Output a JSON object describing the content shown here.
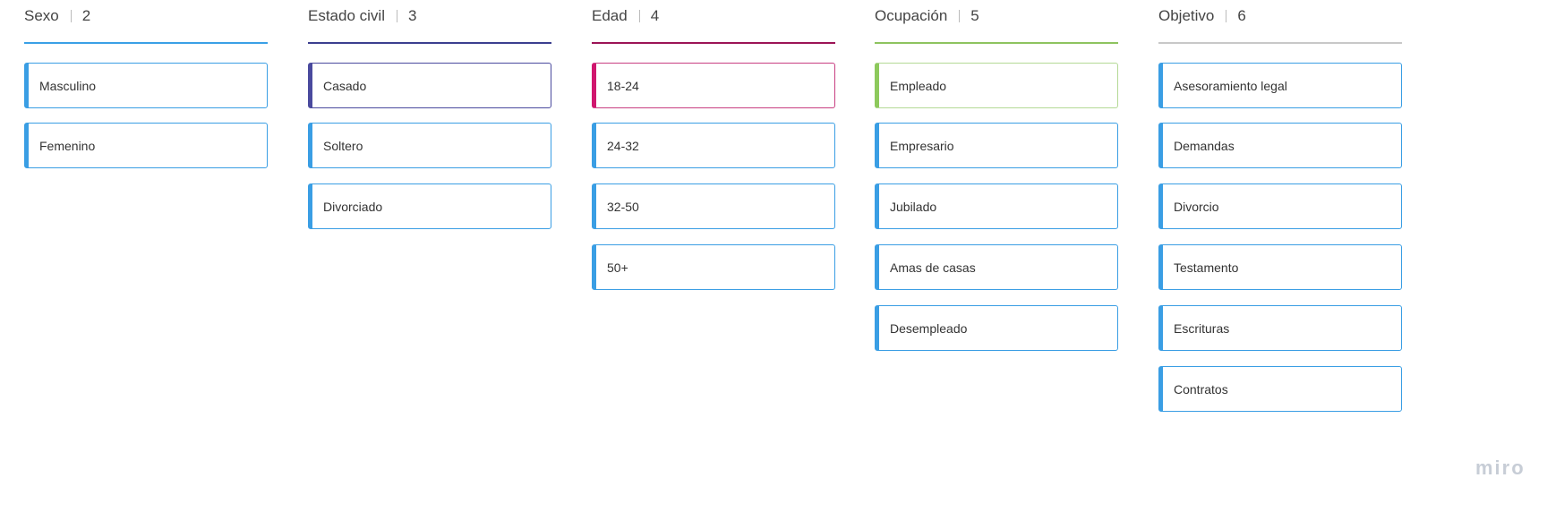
{
  "columns": [
    {
      "title": "Sexo",
      "count": "2",
      "rule_color": "#3aa0e6",
      "items": [
        {
          "label": "Masculino",
          "border": "#3a9ee4",
          "accent": "#3a9ee4"
        },
        {
          "label": "Femenino",
          "border": "#3a9ee4",
          "accent": "#3a9ee4"
        }
      ]
    },
    {
      "title": "Estado civil",
      "count": "3",
      "rule_color": "#3c3f8f",
      "items": [
        {
          "label": "Casado",
          "border": "#4a4a9e",
          "accent": "#4a4a9e"
        },
        {
          "label": "Soltero",
          "border": "#3a9ee4",
          "accent": "#3a9ee4"
        },
        {
          "label": "Divorciado",
          "border": "#3a9ee4",
          "accent": "#3a9ee4"
        }
      ]
    },
    {
      "title": "Edad",
      "count": "4",
      "rule_color": "#9c1456",
      "items": [
        {
          "label": "18-24",
          "border": "#c83f82",
          "accent": "#d0166e"
        },
        {
          "label": "24-32",
          "border": "#3a9ee4",
          "accent": "#3a9ee4"
        },
        {
          "label": "32-50",
          "border": "#3a9ee4",
          "accent": "#3a9ee4"
        },
        {
          "label": "50+",
          "border": "#3a9ee4",
          "accent": "#3a9ee4"
        }
      ]
    },
    {
      "title": "Ocupación",
      "count": "5",
      "rule_color": "#8ec35f",
      "items": [
        {
          "label": "Empleado",
          "border": "#b4d996",
          "accent": "#8dc95c"
        },
        {
          "label": "Empresario",
          "border": "#3a9ee4",
          "accent": "#3a9ee4"
        },
        {
          "label": "Jubilado",
          "border": "#3a9ee4",
          "accent": "#3a9ee4"
        },
        {
          "label": "Amas de casas",
          "border": "#3a9ee4",
          "accent": "#3a9ee4"
        },
        {
          "label": "Desempleado",
          "border": "#3a9ee4",
          "accent": "#3a9ee4"
        }
      ]
    },
    {
      "title": "Objetivo",
      "count": "6",
      "rule_color": "#c8c8c8",
      "items": [
        {
          "label": "Asesoramiento legal",
          "border": "#3a9ee4",
          "accent": "#3a9ee4"
        },
        {
          "label": "Demandas",
          "border": "#3a9ee4",
          "accent": "#3a9ee4"
        },
        {
          "label": "Divorcio",
          "border": "#3a9ee4",
          "accent": "#3a9ee4"
        },
        {
          "label": "Testamento",
          "border": "#3a9ee4",
          "accent": "#3a9ee4"
        },
        {
          "label": "Escrituras",
          "border": "#3a9ee4",
          "accent": "#3a9ee4"
        },
        {
          "label": "Contratos",
          "border": "#3a9ee4",
          "accent": "#3a9ee4"
        }
      ]
    }
  ],
  "watermark": "miro"
}
